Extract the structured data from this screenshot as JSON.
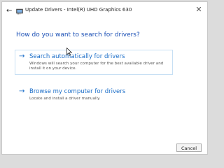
{
  "window": {
    "title": "Update Drivers - Intel(R) UHD Graphics 630",
    "close_glyph": "✕",
    "back_glyph": "←"
  },
  "heading": "How do you want to search for drivers?",
  "options": [
    {
      "arrow": "→",
      "title": "Search automatically for drivers",
      "description": "Windows will search your computer for the best available driver and install it on your device."
    },
    {
      "arrow": "→",
      "title": "Browse my computer for drivers",
      "description": "Locate and install a driver manually."
    }
  ],
  "footer": {
    "cancel_label": "Cancel"
  },
  "colors": {
    "accent": "#1a6dc8",
    "heading": "#1a4fb5",
    "option_border": "#c7e0f4"
  },
  "icons": {
    "title_icon": "display-adapter-icon",
    "back": "back-arrow-icon",
    "close": "close-icon"
  }
}
